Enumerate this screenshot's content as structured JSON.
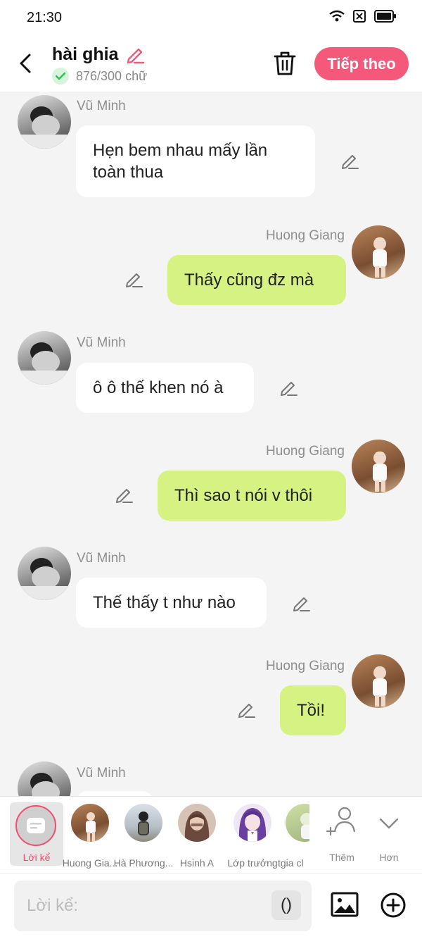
{
  "status_bar": {
    "time": "21:30"
  },
  "header": {
    "title": "hài ghia",
    "word_count": "876/300 chữ",
    "next_button": "Tiếp theo"
  },
  "messages": [
    {
      "side": "left",
      "name": "Vũ Minh",
      "text": "Hẹn bem nhau mấy lần toàn thua"
    },
    {
      "side": "right",
      "name": "Huong Giang",
      "text": "Thấy cũng đz mà"
    },
    {
      "side": "left",
      "name": "Vũ Minh",
      "text": "ô ô thế khen nó à"
    },
    {
      "side": "right",
      "name": "Huong Giang",
      "text": "Thì sao t nói v thôi"
    },
    {
      "side": "left",
      "name": "Vũ Minh",
      "text": "Thế thấy t như nào"
    },
    {
      "side": "right",
      "name": "Huong Giang",
      "text": "Tồi!"
    },
    {
      "side": "left",
      "name": "Vũ Minh",
      "text": ""
    }
  ],
  "characters": {
    "narrator_label": "Lời kể",
    "items": [
      {
        "label": "Huong Gia..."
      },
      {
        "label": "Hà Phương..."
      },
      {
        "label": "Hsinh A"
      },
      {
        "label": "Lớp trưởng"
      },
      {
        "label": "tgia cl"
      }
    ],
    "add_label": "Thêm",
    "more_label": "Hơn"
  },
  "input": {
    "placeholder": "Lời kể:",
    "paren_button": "()"
  },
  "colors": {
    "accent": "#f4587a",
    "right_bubble": "#d6f283",
    "left_bubble": "#ffffff"
  },
  "icons": [
    "back-arrow-icon",
    "pencil-icon",
    "check-icon",
    "trash-icon",
    "wifi-icon",
    "sim-icon",
    "battery-icon",
    "add-person-icon",
    "chevron-down-icon",
    "image-icon",
    "plus-circle-icon"
  ]
}
